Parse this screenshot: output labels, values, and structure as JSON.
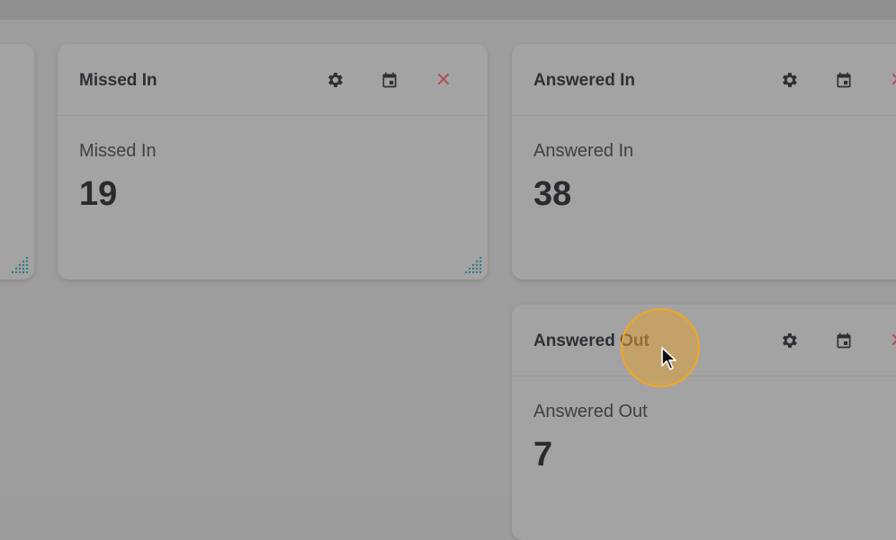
{
  "widgets": [
    {
      "title": "Missed In",
      "label": "Missed In",
      "value": "19"
    },
    {
      "title": "Answered In",
      "label": "Answered In",
      "value": "38"
    },
    {
      "title": "Answered Out",
      "label": "Answered Out",
      "value": "7"
    }
  ],
  "icons": {
    "settings": "gear-icon",
    "calendar": "calendar-icon",
    "close": "close-icon",
    "resize": "resize-grip-icon"
  },
  "colors": {
    "close_icon": "#b0525b",
    "cursor_highlight": "#f0a623",
    "resize_grip": "#2f7f86"
  }
}
